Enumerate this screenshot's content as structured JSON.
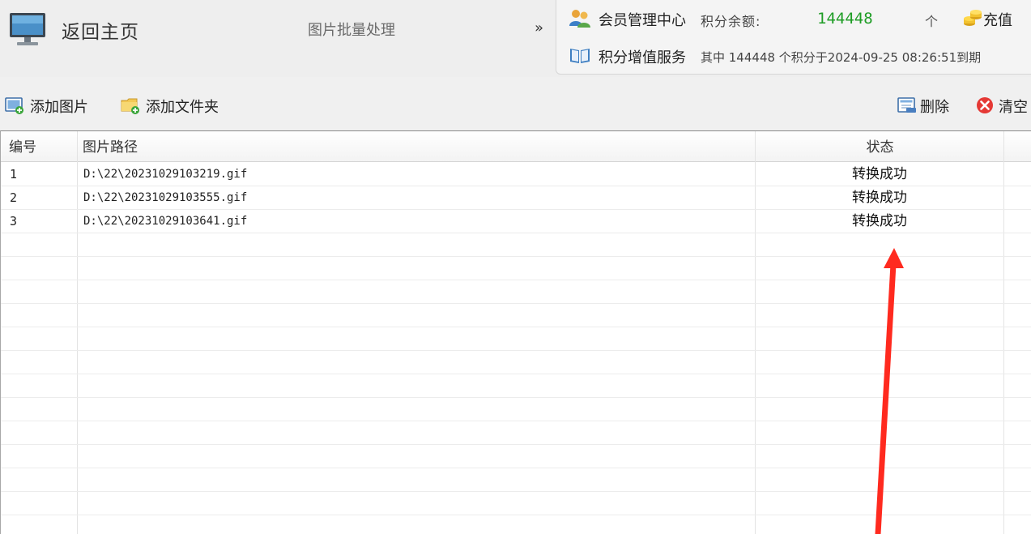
{
  "header": {
    "home_label": "返回主页",
    "page_title": "图片批量处理",
    "expand_glyph": "»"
  },
  "member": {
    "center_label": "会员管理中心",
    "points_label": "积分余额:",
    "points_value": "144448",
    "points_unit": "个",
    "recharge_label": "充值",
    "service_label": "积分增值服务",
    "expire_text": "其中 144448 个积分于2024-09-25 08:26:51到期"
  },
  "toolbar": {
    "add_image": "添加图片",
    "add_folder": "添加文件夹",
    "delete": "删除",
    "clear": "清空"
  },
  "table": {
    "headers": {
      "no": "编号",
      "path": "图片路径",
      "status": "状态"
    },
    "rows": [
      {
        "no": "1",
        "path": "D:\\22\\20231029103219.gif",
        "status": "转换成功"
      },
      {
        "no": "2",
        "path": "D:\\22\\20231029103555.gif",
        "status": "转换成功"
      },
      {
        "no": "3",
        "path": "D:\\22\\20231029103641.gif",
        "status": "转换成功"
      }
    ]
  },
  "colors": {
    "points_green": "#1f9d26",
    "annotation_red": "#ff2a1f",
    "clear_red": "#e53935"
  },
  "icons": {
    "home": "monitor-icon",
    "member": "people-icon",
    "service": "book-icon",
    "recharge": "coin-stack-icon",
    "add_image": "image-add-icon",
    "add_folder": "folder-add-icon",
    "delete": "delete-list-icon",
    "clear": "clear-x-icon"
  }
}
